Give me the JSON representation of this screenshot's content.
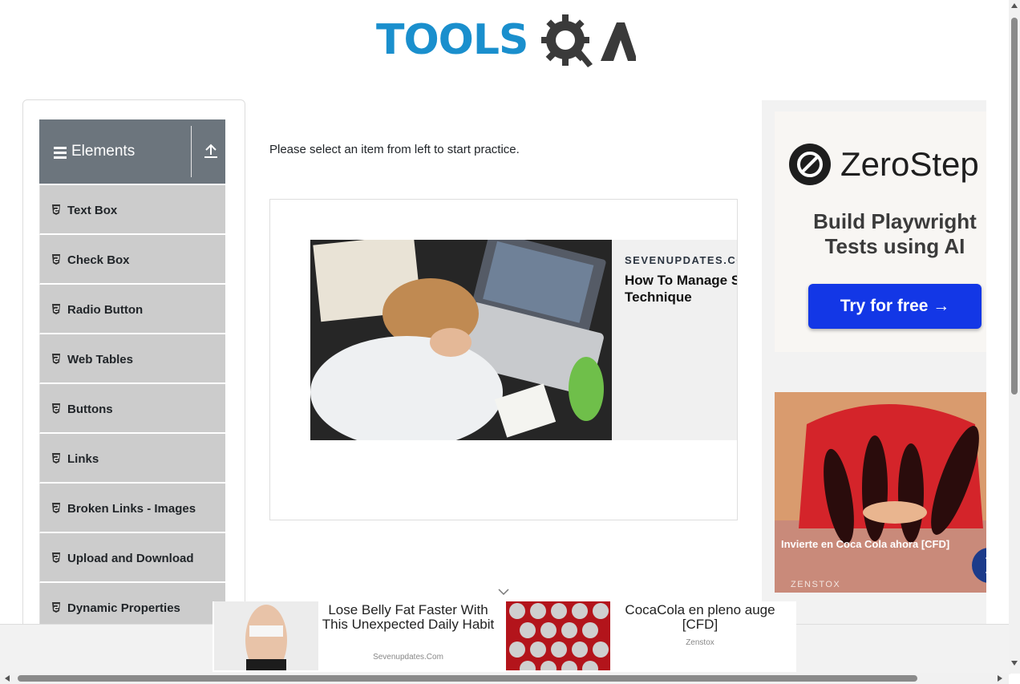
{
  "header": {
    "logo_text": "TOOLSQA"
  },
  "sidebar": {
    "group_title": "Elements",
    "items": [
      {
        "label": "Text Box"
      },
      {
        "label": "Check Box"
      },
      {
        "label": "Radio Button"
      },
      {
        "label": "Web Tables"
      },
      {
        "label": "Buttons"
      },
      {
        "label": "Links"
      },
      {
        "label": "Broken Links - Images"
      },
      {
        "label": "Upload and Download"
      },
      {
        "label": "Dynamic Properties"
      }
    ]
  },
  "main": {
    "intro_text": "Please select an item from left to start practice.",
    "ad": {
      "source": "SEVENUPDATES.COM",
      "headline_line1": "How To Manage Stre",
      "headline_line2": "Technique"
    }
  },
  "right_ad": {
    "brand": "ZeroStep",
    "tagline_line1": "Build Playwright",
    "tagline_line2": "Tests using AI",
    "cta": "Try for free →",
    "second_caption": "Invierte en Coca Cola ahora [CFD]",
    "second_source": "ZENSTOX"
  },
  "bottom_ads": [
    {
      "headline": "Lose Belly Fat Faster With This Unexpected Daily Habit",
      "source": "Sevenupdates.Com"
    },
    {
      "headline": "CocaCola en pleno auge [CFD]",
      "source": "Zenstox"
    }
  ],
  "colors": {
    "brand_blue": "#1a8fcd",
    "header_gray": "#6c757d",
    "menu_gray": "#cccccc",
    "cta_blue": "#1337e6"
  }
}
